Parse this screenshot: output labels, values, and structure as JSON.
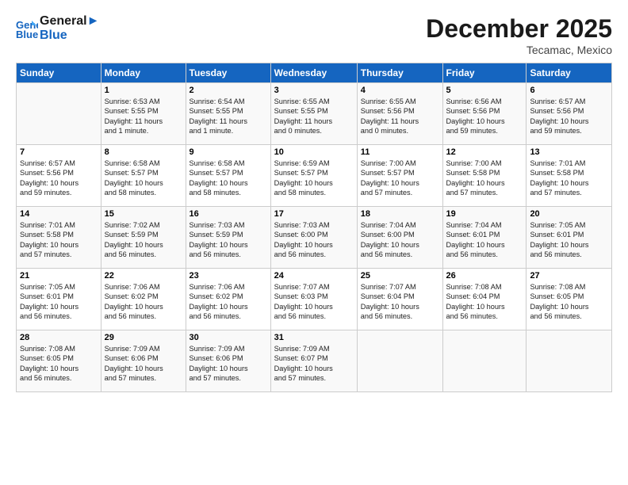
{
  "header": {
    "logo_line1": "General",
    "logo_line2": "Blue",
    "month": "December 2025",
    "location": "Tecamac, Mexico"
  },
  "weekdays": [
    "Sunday",
    "Monday",
    "Tuesday",
    "Wednesday",
    "Thursday",
    "Friday",
    "Saturday"
  ],
  "weeks": [
    [
      {
        "day": "",
        "info": ""
      },
      {
        "day": "1",
        "info": "Sunrise: 6:53 AM\nSunset: 5:55 PM\nDaylight: 11 hours\nand 1 minute."
      },
      {
        "day": "2",
        "info": "Sunrise: 6:54 AM\nSunset: 5:55 PM\nDaylight: 11 hours\nand 1 minute."
      },
      {
        "day": "3",
        "info": "Sunrise: 6:55 AM\nSunset: 5:55 PM\nDaylight: 11 hours\nand 0 minutes."
      },
      {
        "day": "4",
        "info": "Sunrise: 6:55 AM\nSunset: 5:56 PM\nDaylight: 11 hours\nand 0 minutes."
      },
      {
        "day": "5",
        "info": "Sunrise: 6:56 AM\nSunset: 5:56 PM\nDaylight: 10 hours\nand 59 minutes."
      },
      {
        "day": "6",
        "info": "Sunrise: 6:57 AM\nSunset: 5:56 PM\nDaylight: 10 hours\nand 59 minutes."
      }
    ],
    [
      {
        "day": "7",
        "info": "Sunrise: 6:57 AM\nSunset: 5:56 PM\nDaylight: 10 hours\nand 59 minutes."
      },
      {
        "day": "8",
        "info": "Sunrise: 6:58 AM\nSunset: 5:57 PM\nDaylight: 10 hours\nand 58 minutes."
      },
      {
        "day": "9",
        "info": "Sunrise: 6:58 AM\nSunset: 5:57 PM\nDaylight: 10 hours\nand 58 minutes."
      },
      {
        "day": "10",
        "info": "Sunrise: 6:59 AM\nSunset: 5:57 PM\nDaylight: 10 hours\nand 58 minutes."
      },
      {
        "day": "11",
        "info": "Sunrise: 7:00 AM\nSunset: 5:57 PM\nDaylight: 10 hours\nand 57 minutes."
      },
      {
        "day": "12",
        "info": "Sunrise: 7:00 AM\nSunset: 5:58 PM\nDaylight: 10 hours\nand 57 minutes."
      },
      {
        "day": "13",
        "info": "Sunrise: 7:01 AM\nSunset: 5:58 PM\nDaylight: 10 hours\nand 57 minutes."
      }
    ],
    [
      {
        "day": "14",
        "info": "Sunrise: 7:01 AM\nSunset: 5:58 PM\nDaylight: 10 hours\nand 57 minutes."
      },
      {
        "day": "15",
        "info": "Sunrise: 7:02 AM\nSunset: 5:59 PM\nDaylight: 10 hours\nand 56 minutes."
      },
      {
        "day": "16",
        "info": "Sunrise: 7:03 AM\nSunset: 5:59 PM\nDaylight: 10 hours\nand 56 minutes."
      },
      {
        "day": "17",
        "info": "Sunrise: 7:03 AM\nSunset: 6:00 PM\nDaylight: 10 hours\nand 56 minutes."
      },
      {
        "day": "18",
        "info": "Sunrise: 7:04 AM\nSunset: 6:00 PM\nDaylight: 10 hours\nand 56 minutes."
      },
      {
        "day": "19",
        "info": "Sunrise: 7:04 AM\nSunset: 6:01 PM\nDaylight: 10 hours\nand 56 minutes."
      },
      {
        "day": "20",
        "info": "Sunrise: 7:05 AM\nSunset: 6:01 PM\nDaylight: 10 hours\nand 56 minutes."
      }
    ],
    [
      {
        "day": "21",
        "info": "Sunrise: 7:05 AM\nSunset: 6:01 PM\nDaylight: 10 hours\nand 56 minutes."
      },
      {
        "day": "22",
        "info": "Sunrise: 7:06 AM\nSunset: 6:02 PM\nDaylight: 10 hours\nand 56 minutes."
      },
      {
        "day": "23",
        "info": "Sunrise: 7:06 AM\nSunset: 6:02 PM\nDaylight: 10 hours\nand 56 minutes."
      },
      {
        "day": "24",
        "info": "Sunrise: 7:07 AM\nSunset: 6:03 PM\nDaylight: 10 hours\nand 56 minutes."
      },
      {
        "day": "25",
        "info": "Sunrise: 7:07 AM\nSunset: 6:04 PM\nDaylight: 10 hours\nand 56 minutes."
      },
      {
        "day": "26",
        "info": "Sunrise: 7:08 AM\nSunset: 6:04 PM\nDaylight: 10 hours\nand 56 minutes."
      },
      {
        "day": "27",
        "info": "Sunrise: 7:08 AM\nSunset: 6:05 PM\nDaylight: 10 hours\nand 56 minutes."
      }
    ],
    [
      {
        "day": "28",
        "info": "Sunrise: 7:08 AM\nSunset: 6:05 PM\nDaylight: 10 hours\nand 56 minutes."
      },
      {
        "day": "29",
        "info": "Sunrise: 7:09 AM\nSunset: 6:06 PM\nDaylight: 10 hours\nand 57 minutes."
      },
      {
        "day": "30",
        "info": "Sunrise: 7:09 AM\nSunset: 6:06 PM\nDaylight: 10 hours\nand 57 minutes."
      },
      {
        "day": "31",
        "info": "Sunrise: 7:09 AM\nSunset: 6:07 PM\nDaylight: 10 hours\nand 57 minutes."
      },
      {
        "day": "",
        "info": ""
      },
      {
        "day": "",
        "info": ""
      },
      {
        "day": "",
        "info": ""
      }
    ]
  ]
}
